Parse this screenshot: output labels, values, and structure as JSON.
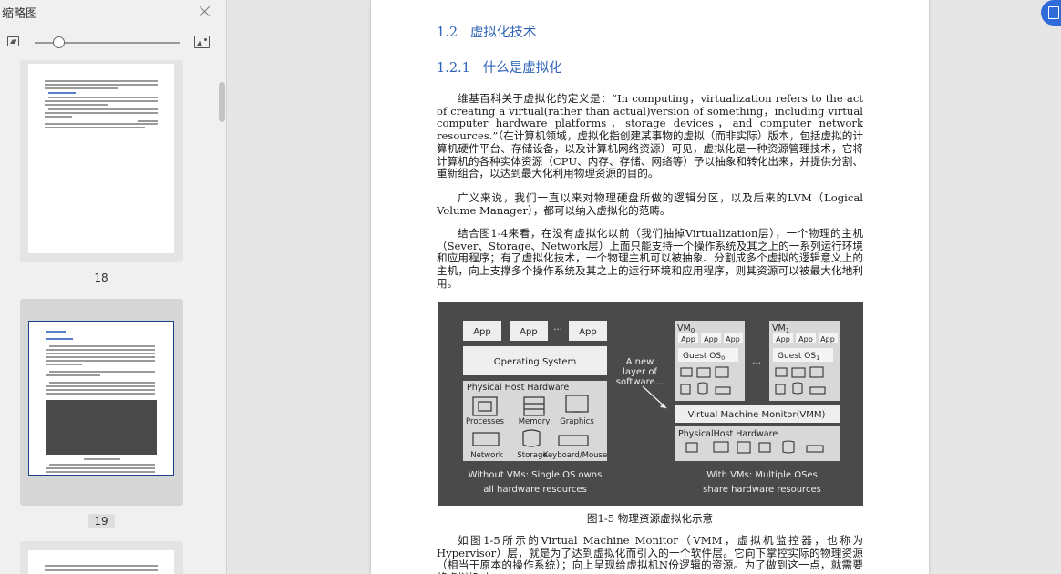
{
  "sidebar": {
    "title": "缩略图",
    "thumbnails": [
      {
        "page_number": "18"
      },
      {
        "page_number": "19"
      }
    ]
  },
  "document": {
    "heading1": "1.2   虚拟化技术",
    "heading2": "1.2.1   什么是虚拟化",
    "para1": "维基百科关于虚拟化的定义是：“In computing，virtualization refers to the act of creating a virtual(rather than actual)version of something，including virtual computer hardware platforms，storage devices，and computer network resources.”（在计算机领域，虚拟化指创建某事物的虚拟（而非实际）版本，包括虚拟的计算机硬件平台、存储设备，以及计算机网络资源）可见，虚拟化是一种资源管理技术，它将计算机的各种实体资源（CPU、内存、存储、网络等）予以抽象和转化出来，并提供分割、重新组合，以达到最大化利用物理资源的目的。",
    "para2": "广义来说，我们一直以来对物理硬盘所做的逻辑分区，以及后来的LVM（Logical Volume Manager），都可以纳入虚拟化的范畴。",
    "para3": "结合图1-4来看，在没有虚拟化以前（我们抽掉Virtualization层），一个物理的主机（Sever、Storage、Network层）上面只能支持一个操作系统及其之上的一系列运行环境和应用程序；有了虚拟化技术，一个物理主机可以被抽象、分割成多个虚拟的逻辑意义上的主机，向上支撑多个操作系统及其之上的运行环境和应用程序，则其资源可以被最大化地利用。",
    "figure": {
      "app": "App",
      "ellipsis": "···",
      "os": "Operating System",
      "phys_hw": "Physical Host Hardware",
      "processes": "Processes",
      "memory": "Memory",
      "graphics": "Graphics",
      "network": "Network",
      "storage": "Storage",
      "keyboard_mouse": "Keyboard/Mouse",
      "new_layer_1": "A new",
      "new_layer_2": "layer of",
      "new_layer_3": "software...",
      "vm0": "VM",
      "vm0_sub": "0",
      "vm1": "VM",
      "vm1_sub": "1",
      "guest_os": "Guest OS",
      "guest_os0_sub": "0",
      "guest_os1_sub": "1",
      "vmm": "Virtual Machine Monitor(VMM)",
      "phys_hw2": "PhysicalHost Hardware",
      "left_caption_1": "Without VMs: Single OS owns",
      "left_caption_2": "all hardware resources",
      "right_caption_1": "With VMs: Multiple OSes",
      "right_caption_2": "share hardware resources"
    },
    "caption": "图1-5   物理资源虚拟化示意",
    "para4": "如图1-5所示的Virtual Machine Monitor（VMM，虚拟机监控器，也称为Hypervisor）层，就是为了达到虚拟化而引入的一个软件层。它向下掌控实际的物理资源（相当于原本的操作系统）；向上呈现给虚拟机N份逻辑的资源。为了做到这一点，就需要将虚拟机对"
  }
}
